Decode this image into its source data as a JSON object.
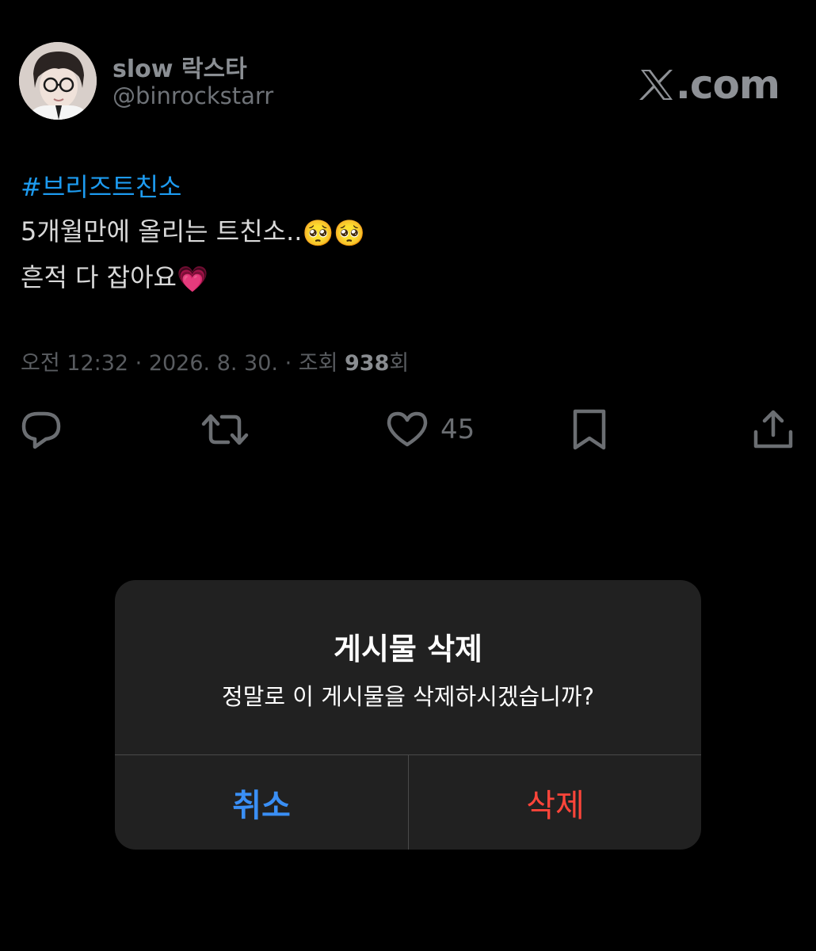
{
  "profile": {
    "display_name": "slow 락스타",
    "handle": "@binrockstarr"
  },
  "watermark": {
    "text": ".com"
  },
  "tweet": {
    "hashtag": "#브리즈트친소",
    "line1": "5개월만에 올리는 트친소..",
    "line1_emojis": "🥺🥺",
    "line2": "흔적 다 잡아요",
    "line2_emoji": "💗"
  },
  "meta": {
    "time": "오전 12:32",
    "separator1": " · ",
    "date": "2026. 8. 30.",
    "separator2": " · ",
    "views_label": "조회 ",
    "views_count": "938",
    "views_suffix": "회"
  },
  "actions": {
    "like_count": "45"
  },
  "alert": {
    "title": "게시물 삭제",
    "message": "정말로 이 게시물을 삭제하시겠습니까?",
    "cancel_label": "취소",
    "delete_label": "삭제"
  },
  "colors": {
    "background": "#000000",
    "hashtag": "#1d9bf0",
    "cancel": "#3a8ff5",
    "delete": "#ff453a",
    "dialog": "#212121"
  }
}
